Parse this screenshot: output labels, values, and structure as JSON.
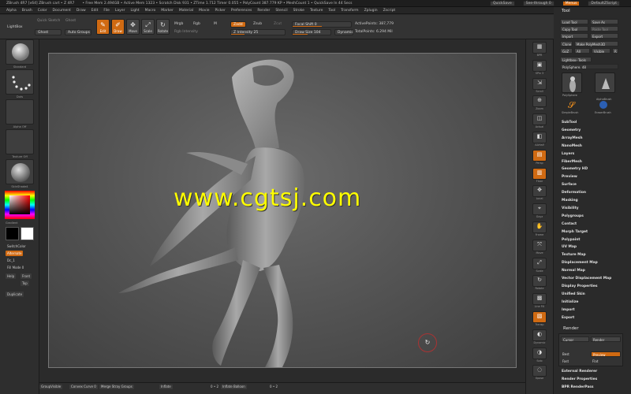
{
  "titlebar": {
    "left": "ZBrush 4R7 [x64]  ZBrush   cart • Z 4R7",
    "status": "• Free Mem 2.494GB • Active Mem 1323 • Scratch Disk 931 • ZTime 1.712 Timer 0.055 • PolyCount 387.779 KP • MeshCount 1 • QuickSave In 44 Secs",
    "quicksave": "QuickSave",
    "seethrough": "See-through 0",
    "menus_btn": "Menus",
    "default_script": "DefaultZScript"
  },
  "menubar": [
    "Alpha",
    "Brush",
    "Color",
    "Document",
    "Draw",
    "Edit",
    "File",
    "Layer",
    "Light",
    "Macro",
    "Marker",
    "Material",
    "Movie",
    "Picker",
    "Preferences",
    "Render",
    "Stencil",
    "Stroke",
    "Texture",
    "Tool",
    "Transform",
    "Zplugin",
    "Zscript"
  ],
  "shelf": {
    "lightbox": "LightBox",
    "quick_sketch": "Quick Sketch",
    "ghost_btn": "Ghost",
    "auto_groups": "Auto Groups",
    "edit": "Edit",
    "draw": "Draw",
    "move": "Move",
    "scale": "Scale",
    "rotate": "Rotate",
    "mrgb": "Mrgb",
    "rgb": "Rgb",
    "m": "M",
    "rgb_intensity": "Rgb Intensity",
    "zadd": "Zadd",
    "zsub": "Zsub",
    "zcut": "Zcut",
    "z_intensity": "Z Intensity 25",
    "focal_shift": "Focal Shift 0",
    "draw_size": "Draw Size 104",
    "dynamic": "Dynamic",
    "active_points": "ActivePoints: 387,779",
    "total_points": "TotalPoints: 6.294 Mil"
  },
  "lefttray": {
    "thumb_captions": [
      "Standard",
      "Dots",
      "Alpha Off",
      "Texture Off",
      "SkinShade4"
    ],
    "gradient": "Gradient",
    "switch_color": "SwitchColor",
    "alternate": "Alternate",
    "dots_z": "Dc_1",
    "fill_mode": "Fill Mode 0",
    "help": "Help",
    "front": "Front",
    "top": "Top",
    "duplicate": "Duplicate"
  },
  "watermark": "www.cgtsj.com",
  "bottombar": {
    "group_visible": "GroupVisible",
    "convex_curve": "Convex Curve 0",
    "merge_stray_groups": "Merge Stray Groups",
    "inflate": "Inflate",
    "inflate_balloon": "Inflate Balloon",
    "val1": "0 • 2",
    "val2": "0 • 2"
  },
  "righttray": [
    {
      "glyph": "▦",
      "label": "BPR"
    },
    {
      "glyph": "▣",
      "label": "SPix 3"
    },
    {
      "glyph": "⇲",
      "label": "Scroll"
    },
    {
      "glyph": "⊕",
      "label": "Zoom"
    },
    {
      "glyph": "◫",
      "label": "Actual"
    },
    {
      "glyph": "◧",
      "label": "AAHalf"
    },
    {
      "glyph": "▤",
      "label": "Persp"
    },
    {
      "glyph": "▥",
      "label": "Floor"
    },
    {
      "glyph": "✥",
      "label": "Local"
    },
    {
      "glyph": "⌖",
      "label": "Gxyz"
    },
    {
      "glyph": "✋",
      "label": "Frame"
    },
    {
      "glyph": "⤧",
      "label": "Move"
    },
    {
      "glyph": "⤢",
      "label": "Scale"
    },
    {
      "glyph": "↻",
      "label": "Rotate"
    },
    {
      "glyph": "▩",
      "label": "Line Fill"
    },
    {
      "glyph": "▧",
      "label": "Transp"
    },
    {
      "glyph": "◐",
      "label": "Dynamic"
    },
    {
      "glyph": "◑",
      "label": "Solo"
    },
    {
      "glyph": "◌",
      "label": "Xpose"
    }
  ],
  "toolpanel": {
    "title": "Tool",
    "load_tool": "Load Tool",
    "save_as": "Save As",
    "copy_tool": "Copy Tool",
    "paste_tool": "Paste Tool",
    "import": "Import",
    "export": "Export",
    "clone": "Clone",
    "make_polymesh": "Make PolyMesh3D",
    "goz": "GoZ",
    "all": "All",
    "visible": "Visible",
    "r": "R",
    "lightbox_tools": "Lightbox› Tools",
    "polysphere": "PolySphere. 48",
    "thumb_caps": [
      "PolySphere",
      "SimpleBrush",
      "AlphaBrush",
      "EraserBrush"
    ],
    "sections": [
      "SubTool",
      "Geometry",
      "ArrayMesh",
      "NanoMesh",
      "Layers",
      "FiberMesh",
      "Geometry HD",
      "Preview",
      "Surface",
      "Deformation",
      "Masking",
      "Visibility",
      "Polygroups",
      "Contact",
      "Morph Target",
      "Polypaint",
      "UV Map",
      "Texture Map",
      "Displacement Map",
      "Normal Map",
      "Vector Displacement Map",
      "Display Properties",
      "Unified Skin",
      "Initialize",
      "Import",
      "Export"
    ],
    "render_title": "Render",
    "render": {
      "cursor": "Cursor",
      "render_btn": "Render",
      "best": "Best",
      "preview": "Preview",
      "fast": "Fast",
      "flat": "Flat"
    },
    "render_sections": [
      "External Renderer",
      "Render Properties",
      "BPR RenderPass"
    ]
  },
  "colors": {
    "accent": "#d06a12",
    "watermark": "#ffff00"
  }
}
